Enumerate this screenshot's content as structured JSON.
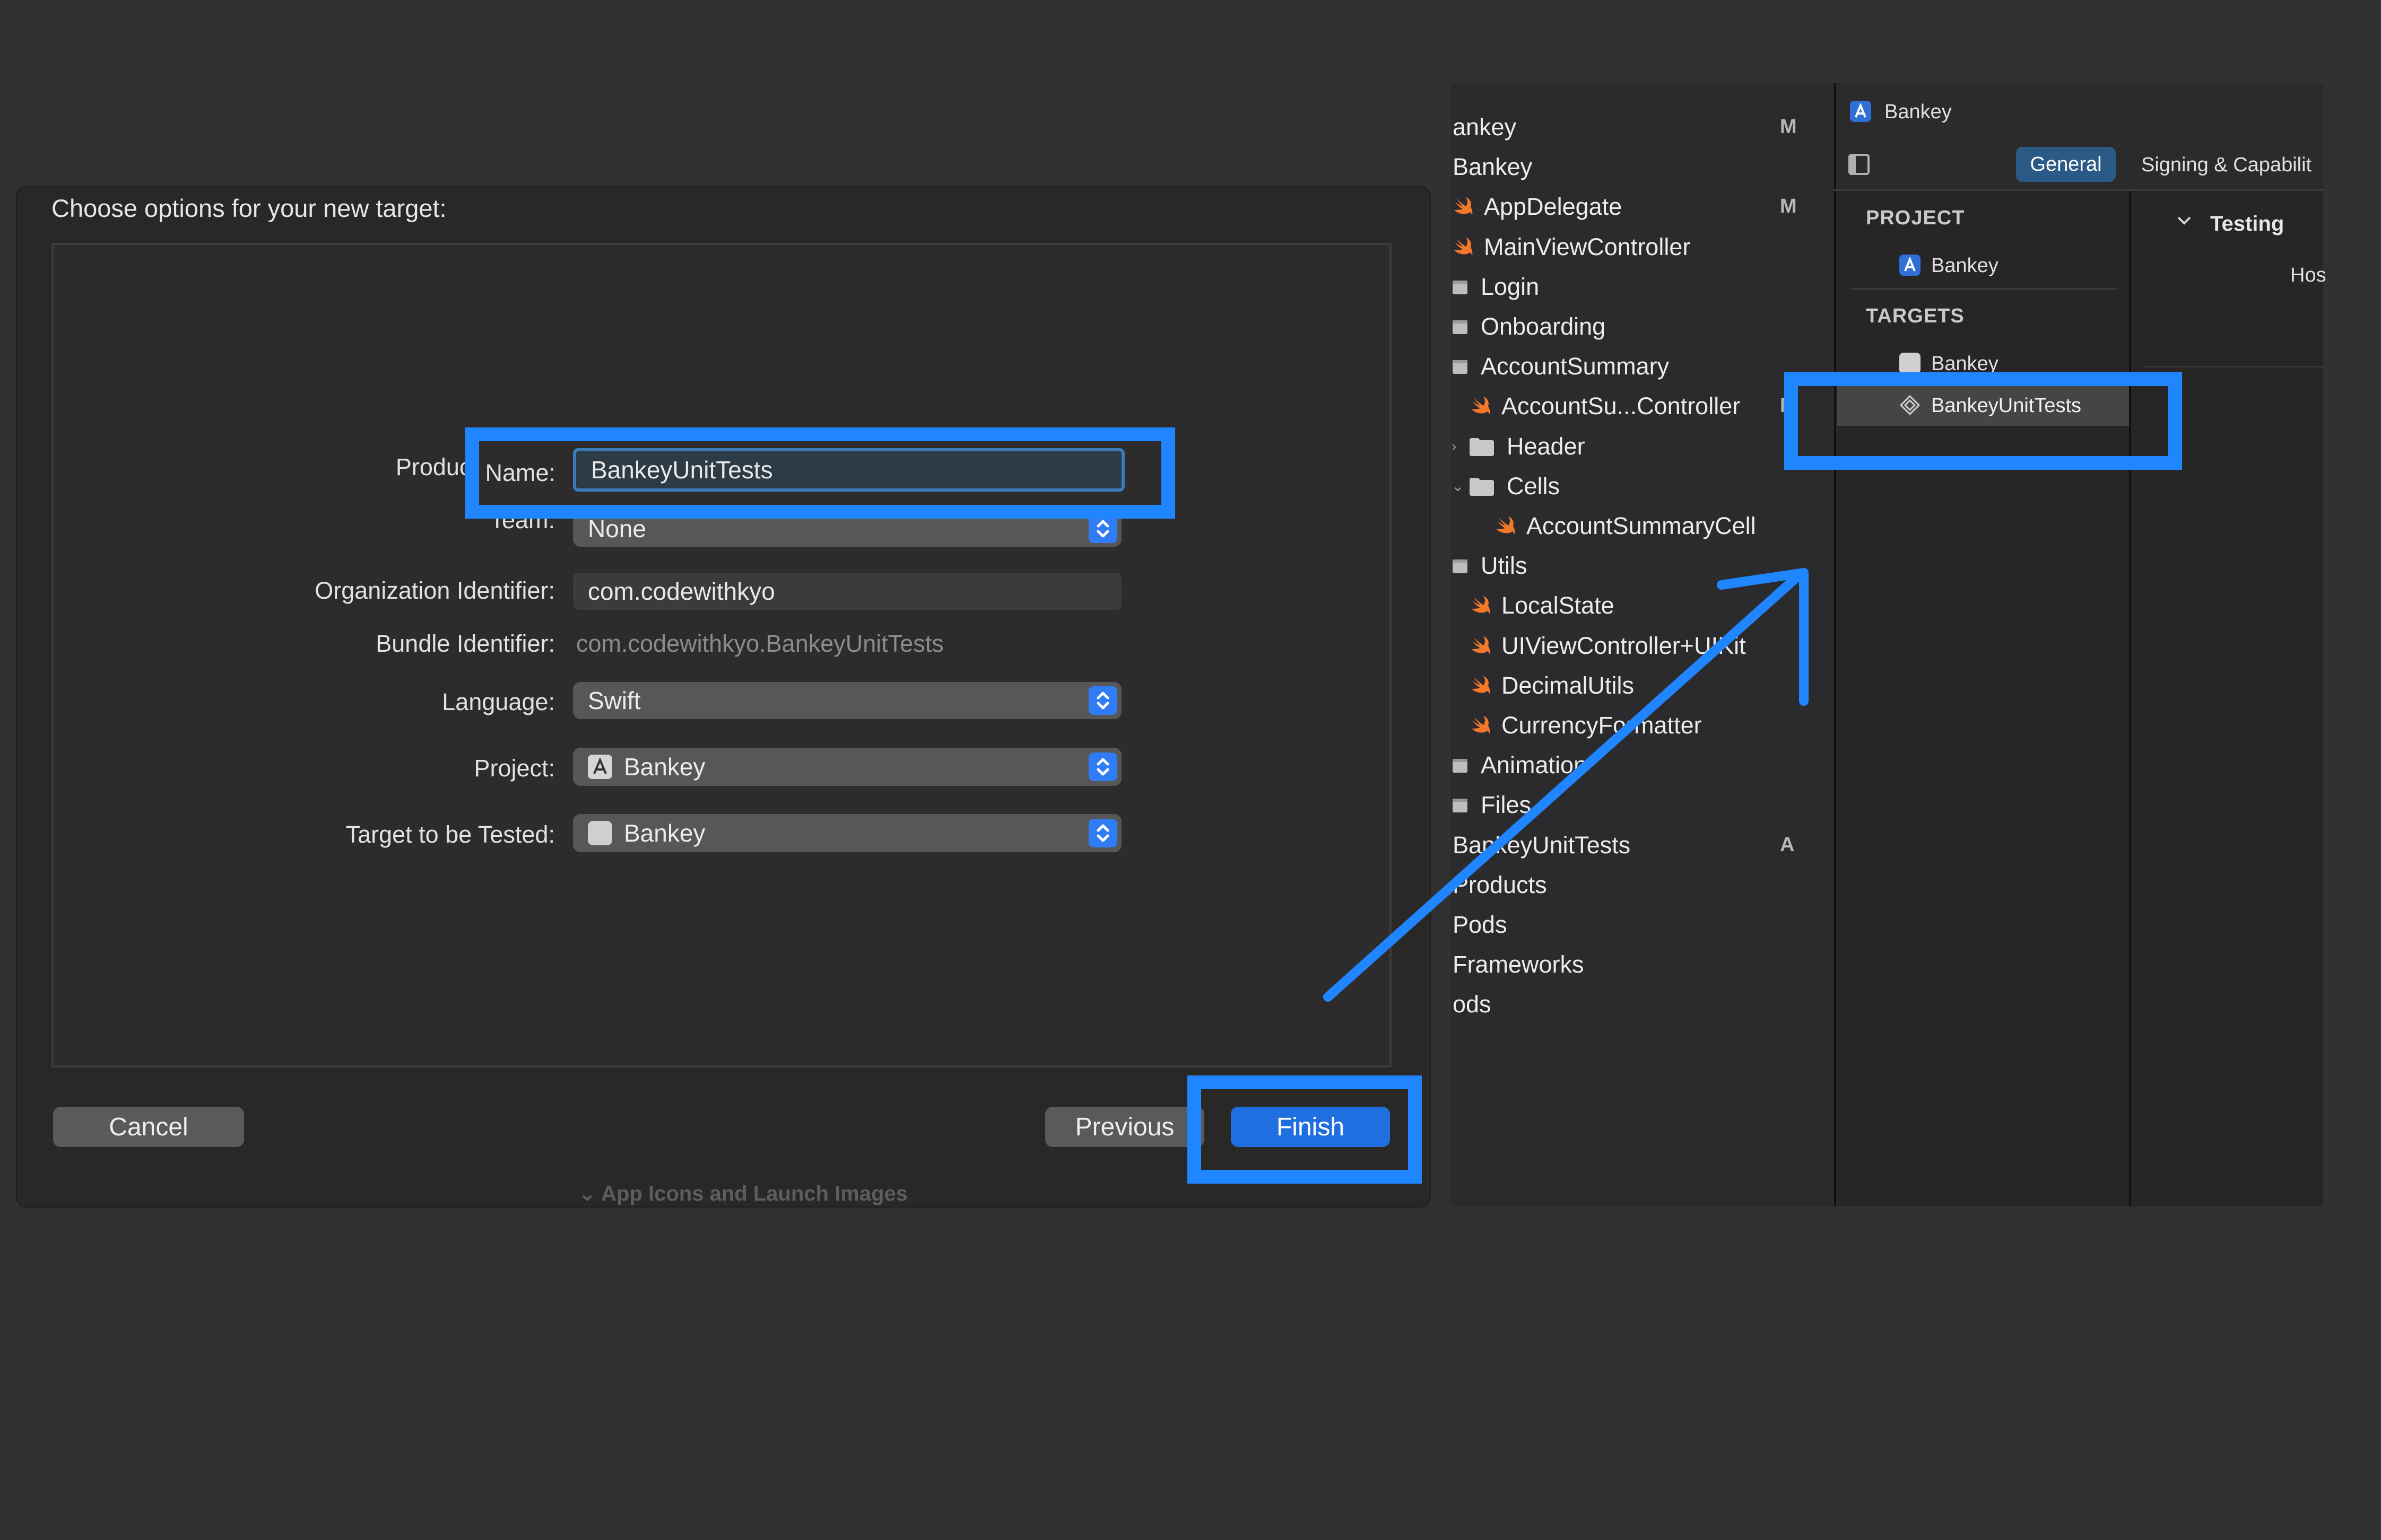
{
  "dialog": {
    "title": "Choose options for your new target:",
    "fields": {
      "product_name_label": "Product Name:",
      "product_name_value": "BankeyUnitTests",
      "team_label": "Team:",
      "team_value": "None",
      "org_id_label": "Organization Identifier:",
      "org_id_value": "com.codewithkyo",
      "bundle_id_label": "Bundle Identifier:",
      "bundle_id_value": "com.codewithkyo.BankeyUnitTests",
      "language_label": "Language:",
      "language_value": "Swift",
      "project_label": "Project:",
      "project_value": "Bankey",
      "target_label": "Target to be Tested:",
      "target_value": "Bankey"
    },
    "buttons": {
      "cancel": "Cancel",
      "previous": "Previous",
      "finish": "Finish"
    },
    "behind_text": "App Icons and Launch Images"
  },
  "navigator": {
    "items": [
      {
        "label": "ankey",
        "badge": "M",
        "icon": "none"
      },
      {
        "label": "Bankey",
        "badge": "",
        "icon": "none"
      },
      {
        "label": "AppDelegate",
        "badge": "M",
        "icon": "swift-icon"
      },
      {
        "label": "MainViewController",
        "badge": "",
        "icon": "swift-icon"
      },
      {
        "label": "Login",
        "badge": "",
        "icon": "folder-icon"
      },
      {
        "label": "Onboarding",
        "badge": "",
        "icon": "folder-icon"
      },
      {
        "label": "AccountSummary",
        "badge": "",
        "icon": "folder-icon"
      },
      {
        "label": "AccountSu...Controller",
        "badge": "M",
        "icon": "swift-icon"
      },
      {
        "label": "Header",
        "badge": "",
        "icon": "folder-icon"
      },
      {
        "label": "Cells",
        "badge": "",
        "icon": "folder-icon"
      },
      {
        "label": "AccountSummaryCell",
        "badge": "",
        "icon": "swift-icon"
      },
      {
        "label": "Utils",
        "badge": "",
        "icon": "folder-icon"
      },
      {
        "label": "LocalState",
        "badge": "",
        "icon": "swift-icon"
      },
      {
        "label": "UIViewController+UIKit",
        "badge": "",
        "icon": "swift-icon"
      },
      {
        "label": "DecimalUtils",
        "badge": "",
        "icon": "swift-icon"
      },
      {
        "label": "CurrencyFormatter",
        "badge": "",
        "icon": "swift-icon"
      },
      {
        "label": "Animation",
        "badge": "",
        "icon": "folder-icon"
      },
      {
        "label": "Files",
        "badge": "",
        "icon": "folder-icon"
      },
      {
        "label": "BankeyUnitTests",
        "badge": "A",
        "icon": "none"
      },
      {
        "label": "Products",
        "badge": "",
        "icon": "none"
      },
      {
        "label": "Pods",
        "badge": "",
        "icon": "none"
      },
      {
        "label": "Frameworks",
        "badge": "",
        "icon": "none"
      },
      {
        "label": "ods",
        "badge": "",
        "icon": "none"
      }
    ]
  },
  "editor": {
    "breadcrumb": "Bankey",
    "tabs": {
      "general": "General",
      "signing": "Signing & Capabilit"
    },
    "project_header": "PROJECT",
    "project_item": "Bankey",
    "targets_header": "TARGETS",
    "target_items": [
      "Bankey",
      "BankeyUnitTests"
    ],
    "section_title": "Testing",
    "section_partial": "Hos"
  },
  "colors": {
    "accent": "#1f86ff",
    "swift": "#f3782c",
    "finish": "#1f6fe0"
  }
}
